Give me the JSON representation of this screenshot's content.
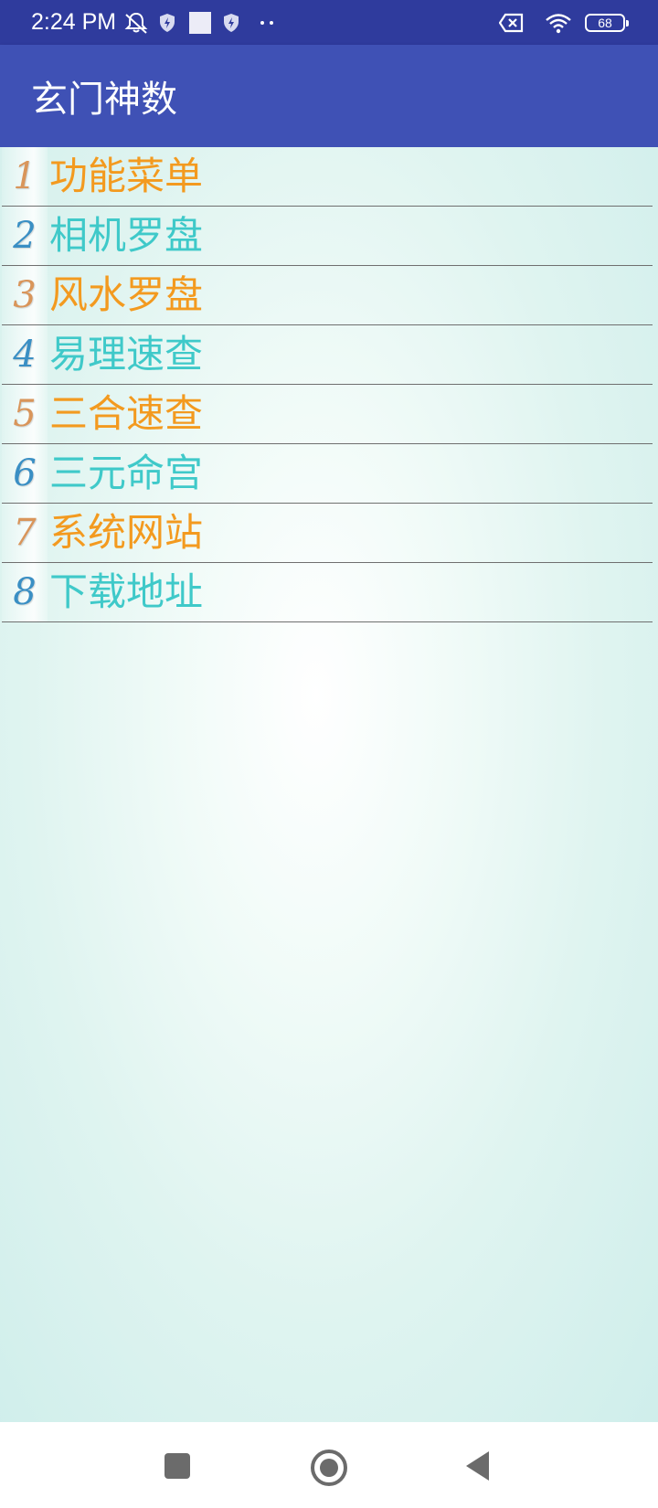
{
  "status_bar": {
    "time": "2:24 PM",
    "icons_left": [
      "silent-bell-icon",
      "shield-icon",
      "square-icon",
      "shield-icon",
      "more-dots-icon"
    ],
    "icons_right": [
      "sim-off-icon",
      "wifi-icon"
    ],
    "battery_level": "68"
  },
  "app_bar": {
    "title": "玄门神数",
    "background": "#3f51b5"
  },
  "menu": {
    "items": [
      {
        "number": "1",
        "label": "功能菜单",
        "color": "#f39a1f"
      },
      {
        "number": "2",
        "label": "相机罗盘",
        "color": "#3fc9c9"
      },
      {
        "number": "3",
        "label": "风水罗盘",
        "color": "#f39a1f"
      },
      {
        "number": "4",
        "label": "易理速查",
        "color": "#3fc9c9"
      },
      {
        "number": "5",
        "label": "三合速查",
        "color": "#f39a1f"
      },
      {
        "number": "6",
        "label": "三元命宫",
        "color": "#3fc9c9"
      },
      {
        "number": "7",
        "label": "系统网站",
        "color": "#f39a1f"
      },
      {
        "number": "8",
        "label": "下载地址",
        "color": "#3fc9c9"
      }
    ],
    "number_colors": {
      "odd": "#d9955a",
      "even": "#3a8fc4"
    }
  },
  "nav_bar": {
    "buttons": [
      "recents-square-icon",
      "home-circle-icon",
      "back-triangle-icon"
    ]
  }
}
